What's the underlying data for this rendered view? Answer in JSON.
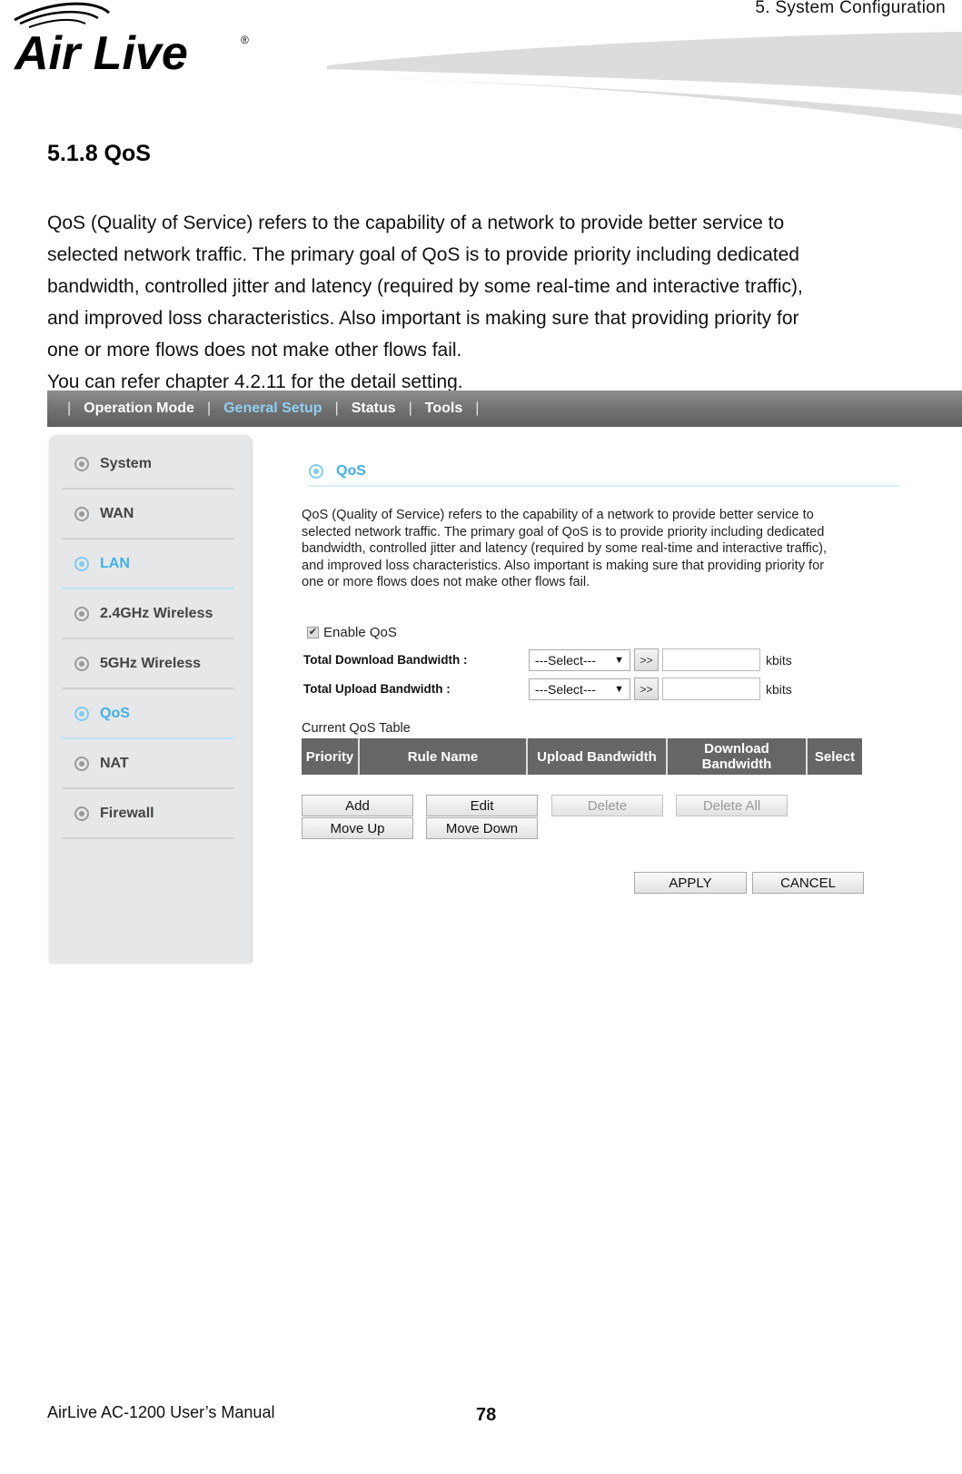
{
  "header": {
    "brand": "Air Live",
    "registered_mark": "®",
    "chapter": "5.  System  Configuration"
  },
  "section": {
    "title": "5.1.8 QoS",
    "paragraph_lines": [
      "QoS (Quality of Service) refers to the capability of a network to provide better service to",
      "selected network traffic. The primary goal of QoS is to provide priority including dedicated",
      "bandwidth, controlled jitter and latency (required by some real-time and interactive traffic),",
      "and improved loss characteristics. Also important is making sure that providing priority for",
      "one or more flows does not make other flows fail.",
      "You can refer chapter 4.2.11 for the detail setting."
    ]
  },
  "ui": {
    "topnav": {
      "items": [
        {
          "label": "Operation Mode",
          "active": false
        },
        {
          "label": "General Setup",
          "active": true
        },
        {
          "label": "Status",
          "active": false
        },
        {
          "label": "Tools",
          "active": false
        }
      ],
      "separator": "|"
    },
    "sidebar": {
      "items": [
        {
          "label": "System",
          "active": false
        },
        {
          "label": "WAN",
          "active": false
        },
        {
          "label": "LAN",
          "active": true
        },
        {
          "label": "2.4GHz Wireless",
          "active": false
        },
        {
          "label": "5GHz Wireless",
          "active": false
        },
        {
          "label": "QoS",
          "active": true
        },
        {
          "label": "NAT",
          "active": false
        },
        {
          "label": "Firewall",
          "active": false
        }
      ]
    },
    "content": {
      "title": "QoS",
      "description_lines": [
        "QoS (Quality of Service) refers to the capability of a network to provide better service to",
        "selected network traffic. The primary goal of QoS is to provide priority including dedicated",
        "bandwidth, controlled jitter and latency (required by some real-time and interactive traffic),",
        "and improved loss characteristics. Also important is making sure that providing priority for",
        "one or more flows does not make other flows fail."
      ],
      "enable_qos": {
        "label": "Enable QoS",
        "checked": true,
        "check_glyph": "✔"
      },
      "download": {
        "label": "Total Download Bandwidth :",
        "select_value": "---Select---",
        "arrow_button": ">>",
        "input_value": "",
        "unit": "kbits"
      },
      "upload": {
        "label": "Total Upload Bandwidth :",
        "select_value": "---Select---",
        "arrow_button": ">>",
        "input_value": "",
        "unit": "kbits"
      },
      "table": {
        "caption": "Current QoS Table",
        "columns": [
          "Priority",
          "Rule Name",
          "Upload Bandwidth",
          "Download Bandwidth",
          "Select"
        ],
        "rows": []
      },
      "buttons": {
        "add": "Add",
        "edit": "Edit",
        "delete": "Delete",
        "delete_all": "Delete All",
        "move_up": "Move Up",
        "move_down": "Move Down",
        "apply": "APPLY",
        "cancel": "CANCEL"
      }
    }
  },
  "footer": {
    "manual": "AirLive AC-1200 User’s Manual",
    "page_number": "78"
  },
  "colors": {
    "accent_blue": "#3fb1e8",
    "nav_active": "#8fd0f2",
    "table_header": "#666666"
  }
}
